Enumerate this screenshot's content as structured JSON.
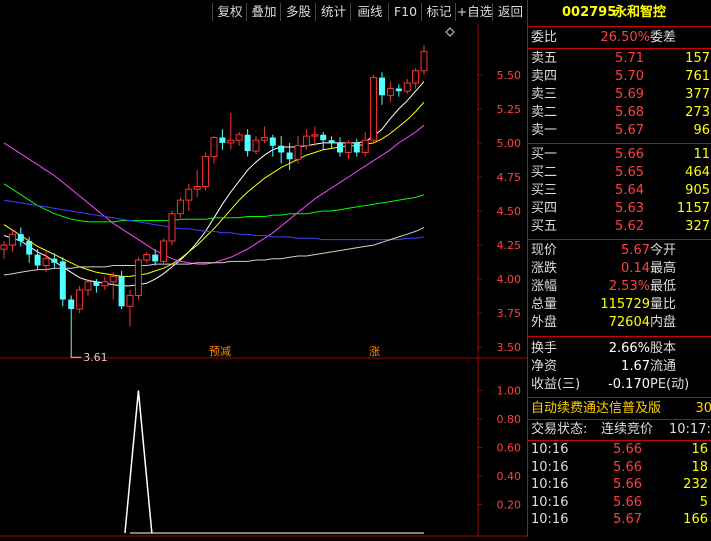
{
  "toolbar": {
    "buttons": [
      "复权",
      "叠加",
      "多股",
      "统计",
      "画线",
      "F10",
      "标记",
      "+自选",
      "返回"
    ]
  },
  "price_axis": {
    "ticks": [
      "5.50",
      "5.25",
      "5.00",
      "4.75",
      "4.50",
      "4.25",
      "4.00",
      "3.75",
      "3.50"
    ],
    "low_label": "3.61",
    "tags": [
      "预减",
      "涨"
    ]
  },
  "indicator_axis": {
    "ticks": [
      "1.00",
      "0.80",
      "0.60",
      "0.40",
      "0.20"
    ]
  },
  "quote": {
    "code": "002795",
    "name": "永和智控",
    "weibi_label": "委比",
    "weibi_value": "26.50%",
    "weicha_label": "委差",
    "asks": [
      {
        "label": "卖五",
        "price": "5.71",
        "vol": "157"
      },
      {
        "label": "卖四",
        "price": "5.70",
        "vol": "761"
      },
      {
        "label": "卖三",
        "price": "5.69",
        "vol": "377"
      },
      {
        "label": "卖二",
        "price": "5.68",
        "vol": "273"
      },
      {
        "label": "卖一",
        "price": "5.67",
        "vol": "96"
      }
    ],
    "bids": [
      {
        "label": "买一",
        "price": "5.66",
        "vol": "11"
      },
      {
        "label": "买二",
        "price": "5.65",
        "vol": "464"
      },
      {
        "label": "买三",
        "price": "5.64",
        "vol": "905"
      },
      {
        "label": "买四",
        "price": "5.63",
        "vol": "1157"
      },
      {
        "label": "买五",
        "price": "5.62",
        "vol": "327"
      }
    ],
    "stats": [
      {
        "l1": "现价",
        "v1": "5.67",
        "l2": "今开"
      },
      {
        "l1": "涨跌",
        "v1": "0.14",
        "l2": "最高"
      },
      {
        "l1": "涨幅",
        "v1": "2.53%",
        "l2": "最低"
      },
      {
        "l1": "总量",
        "v1": "115729",
        "l2": "量比"
      },
      {
        "l1": "外盘",
        "v1": "72604",
        "l2": "内盘"
      }
    ],
    "stats2": [
      {
        "l1": "换手",
        "v1": "2.66%",
        "l2": "股本"
      },
      {
        "l1": "净资",
        "v1": "1.67",
        "l2": "流通"
      },
      {
        "l1": "收益(三)",
        "v1": "-0.170",
        "l2": "PE(动)"
      }
    ],
    "banner": "自动续费通达信普及版",
    "banner_tail": "30",
    "status_label": "交易状态:",
    "status_value": "连续竞价",
    "status_time": "10:17:",
    "ticks": [
      {
        "time": "10:16",
        "price": "5.66",
        "vol": "16"
      },
      {
        "time": "10:16",
        "price": "5.66",
        "vol": "18"
      },
      {
        "time": "10:16",
        "price": "5.66",
        "vol": "232"
      },
      {
        "time": "10:16",
        "price": "5.66",
        "vol": "5"
      },
      {
        "time": "10:16",
        "price": "5.67",
        "vol": "166"
      }
    ]
  },
  "chart_data": {
    "type": "candlestick",
    "y_range": [
      3.45,
      5.8
    ],
    "candles": [
      [
        4.22,
        4.25,
        4.15,
        4.28
      ],
      [
        4.25,
        4.33,
        4.2,
        4.36
      ],
      [
        4.33,
        4.28,
        4.24,
        4.38
      ],
      [
        4.28,
        4.18,
        4.12,
        4.31
      ],
      [
        4.18,
        4.1,
        4.07,
        4.22
      ],
      [
        4.1,
        4.15,
        4.05,
        4.2
      ],
      [
        4.15,
        4.12,
        4.08,
        4.19
      ],
      [
        4.13,
        3.85,
        3.8,
        4.16
      ],
      [
        3.85,
        3.78,
        3.61,
        3.88
      ],
      [
        3.78,
        3.92,
        3.75,
        3.95
      ],
      [
        3.92,
        3.98,
        3.88,
        4.0
      ],
      [
        3.98,
        3.95,
        3.9,
        4.0
      ],
      [
        3.95,
        3.98,
        3.92,
        4.02
      ],
      [
        3.98,
        4.02,
        3.85,
        4.05
      ],
      [
        4.02,
        3.8,
        3.78,
        4.06
      ],
      [
        3.8,
        3.88,
        3.65,
        3.92
      ],
      [
        3.88,
        4.14,
        3.85,
        4.16
      ],
      [
        4.14,
        4.18,
        4.12,
        4.2
      ],
      [
        4.18,
        4.13,
        4.1,
        4.22
      ],
      [
        4.13,
        4.28,
        4.1,
        4.3
      ],
      [
        4.28,
        4.48,
        4.25,
        4.5
      ],
      [
        4.48,
        4.58,
        4.45,
        4.6
      ],
      [
        4.58,
        4.66,
        4.5,
        4.7
      ],
      [
        4.66,
        4.68,
        4.6,
        4.8
      ],
      [
        4.68,
        4.9,
        4.65,
        4.93
      ],
      [
        4.9,
        5.04,
        4.85,
        5.05
      ],
      [
        5.04,
        5.0,
        4.95,
        5.1
      ],
      [
        5.0,
        5.02,
        4.95,
        5.22
      ],
      [
        5.02,
        5.06,
        4.98,
        5.08
      ],
      [
        5.06,
        4.94,
        4.9,
        5.1
      ],
      [
        4.94,
        5.02,
        4.92,
        5.05
      ],
      [
        5.02,
        5.04,
        5.0,
        5.12
      ],
      [
        5.04,
        4.98,
        4.9,
        5.06
      ],
      [
        4.98,
        4.93,
        4.85,
        5.05
      ],
      [
        4.93,
        4.88,
        4.8,
        5.0
      ],
      [
        4.88,
        4.98,
        4.85,
        5.05
      ],
      [
        4.98,
        5.05,
        4.95,
        5.1
      ],
      [
        5.05,
        5.06,
        4.98,
        5.12
      ],
      [
        5.06,
        5.02,
        4.95,
        5.08
      ],
      [
        5.02,
        5.0,
        4.96,
        5.05
      ],
      [
        5.0,
        4.93,
        4.9,
        5.04
      ],
      [
        4.93,
        5.0,
        4.88,
        5.02
      ],
      [
        5.0,
        4.93,
        4.9,
        5.03
      ],
      [
        4.93,
        5.02,
        4.9,
        5.08
      ],
      [
        5.02,
        5.48,
        5.0,
        5.5
      ],
      [
        5.48,
        5.35,
        5.28,
        5.52
      ],
      [
        5.35,
        5.4,
        5.3,
        5.45
      ],
      [
        5.4,
        5.38,
        5.34,
        5.43
      ],
      [
        5.38,
        5.44,
        5.36,
        5.47
      ],
      [
        5.44,
        5.53,
        5.4,
        5.55
      ],
      [
        5.53,
        5.67,
        5.5,
        5.72
      ]
    ],
    "ma_lines": [
      {
        "color": "#ffffff",
        "values": [
          4.32,
          4.3,
          4.28,
          4.24,
          4.2,
          4.17,
          4.13,
          4.09,
          4.05,
          4.01,
          3.99,
          3.98,
          3.97,
          3.96,
          3.95,
          3.95,
          3.96,
          3.97,
          4.0,
          4.04,
          4.09,
          4.14,
          4.2,
          4.27,
          4.35,
          4.45,
          4.55,
          4.64,
          4.72,
          4.8,
          4.86,
          4.91,
          4.95,
          4.97,
          4.97,
          4.97,
          4.98,
          4.99,
          5.0,
          5.0,
          5.0,
          5.0,
          5.0,
          5.01,
          5.05,
          5.1,
          5.18,
          5.25,
          5.31,
          5.38,
          5.45
        ]
      },
      {
        "color": "#ffff00",
        "values": [
          4.4,
          4.36,
          4.32,
          4.28,
          4.24,
          4.21,
          4.18,
          4.15,
          4.12,
          4.09,
          4.07,
          4.05,
          4.04,
          4.03,
          4.02,
          4.02,
          4.03,
          4.04,
          4.06,
          4.08,
          4.11,
          4.15,
          4.2,
          4.25,
          4.31,
          4.37,
          4.44,
          4.51,
          4.58,
          4.64,
          4.69,
          4.74,
          4.78,
          4.82,
          4.85,
          4.88,
          4.91,
          4.93,
          4.95,
          4.96,
          4.97,
          4.98,
          4.98,
          4.99,
          5.0,
          5.03,
          5.07,
          5.12,
          5.17,
          5.23,
          5.3
        ]
      },
      {
        "color": "#ff40ff",
        "values": [
          5.0,
          4.96,
          4.92,
          4.88,
          4.84,
          4.8,
          4.76,
          4.71,
          4.66,
          4.61,
          4.56,
          4.51,
          4.46,
          4.41,
          4.37,
          4.33,
          4.29,
          4.25,
          4.21,
          4.18,
          4.15,
          4.13,
          4.12,
          4.11,
          4.11,
          4.12,
          4.14,
          4.16,
          4.19,
          4.22,
          4.26,
          4.3,
          4.34,
          4.39,
          4.44,
          4.49,
          4.54,
          4.59,
          4.63,
          4.67,
          4.71,
          4.75,
          4.79,
          4.83,
          4.87,
          4.91,
          4.95,
          5.0,
          5.04,
          5.08,
          5.13
        ]
      },
      {
        "color": "#00ff00",
        "values": [
          4.7,
          4.66,
          4.62,
          4.58,
          4.54,
          4.51,
          4.48,
          4.46,
          4.44,
          4.43,
          4.42,
          4.42,
          4.42,
          4.42,
          4.43,
          4.43,
          4.43,
          4.43,
          4.43,
          4.43,
          4.43,
          4.44,
          4.44,
          4.44,
          4.44,
          4.45,
          4.45,
          4.45,
          4.45,
          4.46,
          4.46,
          4.46,
          4.47,
          4.47,
          4.48,
          4.48,
          4.48,
          4.49,
          4.5,
          4.5,
          4.51,
          4.52,
          4.53,
          4.54,
          4.55,
          4.56,
          4.57,
          4.58,
          4.59,
          4.6,
          4.62
        ]
      },
      {
        "color": "#4040ff",
        "values": [
          4.58,
          4.57,
          4.56,
          4.55,
          4.54,
          4.53,
          4.52,
          4.51,
          4.5,
          4.49,
          4.48,
          4.47,
          4.46,
          4.45,
          4.44,
          4.43,
          4.42,
          4.41,
          4.4,
          4.39,
          4.38,
          4.37,
          4.37,
          4.36,
          4.35,
          4.35,
          4.34,
          4.34,
          4.33,
          4.33,
          4.32,
          4.32,
          4.31,
          4.31,
          4.31,
          4.3,
          4.3,
          4.3,
          4.29,
          4.29,
          4.29,
          4.29,
          4.29,
          4.29,
          4.29,
          4.29,
          4.29,
          4.29,
          4.3,
          4.3,
          4.31
        ]
      },
      {
        "color": "#d0d0d0",
        "values": [
          4.03,
          4.04,
          4.05,
          4.06,
          4.07,
          4.07,
          4.08,
          4.08,
          4.08,
          4.09,
          4.09,
          4.09,
          4.09,
          4.1,
          4.1,
          4.1,
          4.1,
          4.1,
          4.11,
          4.11,
          4.11,
          4.11,
          4.11,
          4.12,
          4.12,
          4.12,
          4.12,
          4.13,
          4.13,
          4.13,
          4.14,
          4.14,
          4.15,
          4.15,
          4.16,
          4.17,
          4.17,
          4.18,
          4.19,
          4.2,
          4.21,
          4.22,
          4.23,
          4.24,
          4.25,
          4.27,
          4.29,
          4.31,
          4.33,
          4.35,
          4.38
        ]
      }
    ],
    "indicator": {
      "y_range": [
        0,
        1.2
      ],
      "values": [
        0,
        0,
        0,
        0,
        0,
        0,
        0,
        0,
        0,
        0,
        0,
        0,
        0,
        0,
        0,
        0,
        1,
        0,
        0,
        0,
        0,
        0,
        0,
        0,
        0,
        0,
        0,
        0,
        0,
        0,
        0,
        0,
        0,
        0,
        0,
        0,
        0,
        0,
        0,
        0,
        0,
        0,
        0,
        0,
        0,
        0,
        0,
        0,
        0,
        0,
        0
      ]
    }
  }
}
